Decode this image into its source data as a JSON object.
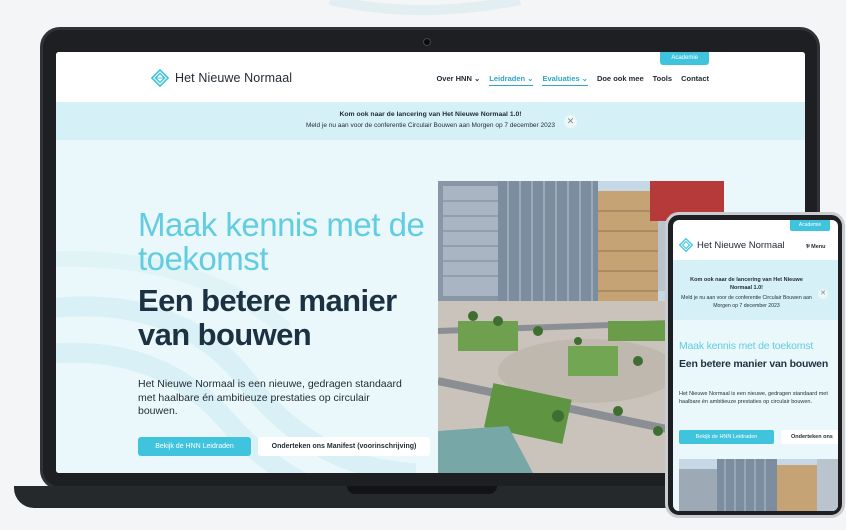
{
  "site": {
    "logo_text": "Het Nieuwe Normaal",
    "academy_tab": "Academie"
  },
  "nav": {
    "items": [
      {
        "label": "Over HNN ⌄"
      },
      {
        "label": "Leidraden ⌄"
      },
      {
        "label": "Evaluaties ⌄"
      },
      {
        "label": "Doe ook mee"
      },
      {
        "label": "Tools"
      },
      {
        "label": "Contact"
      }
    ]
  },
  "banner": {
    "title": "Kom ook naar de lancering van Het Nieuwe Normaal 1.0!",
    "subtitle": "Meld je nu aan voor de conferentie Circulair Bouwen aan Morgen op 7 december 2023",
    "close": "✕"
  },
  "hero": {
    "heading_light": "Maak kennis met de toekomst",
    "heading_bold": "Een betere manier van bouwen",
    "body": "Het Nieuwe Normaal is een nieuwe, gedragen standaard met haalbare én ambitieuze prestaties op circulair bouwen.",
    "primary_button": "Bekijk de HNN Leidraden",
    "secondary_button": "Onderteken ons Manifest (voorinschrijving)"
  },
  "mobile": {
    "logo_text": "Het Nieuwe Normaal",
    "menu_label": "Menu",
    "academy_tab": "Academie",
    "banner_title": "Kom ook naar de lancering van Het Nieuwe Normaal 1.0!",
    "banner_subtitle": "Meld je nu aan voor de conferentie Circulair Bouwen aan Morgen op 7 december 2023",
    "heading_light": "Maak kennis met de toekomst",
    "heading_bold": "Een betere manier van bouwen",
    "body": "Het Nieuwe Normaal is een nieuwe, gedragen standaard met haalbare én ambitieuze prestaties op circulair bouwen.",
    "primary_button": "Bekijk de HNN Leidraden",
    "secondary_button": "Onderteken ons"
  },
  "colors": {
    "accent": "#40c4de",
    "heading_light": "#62cde0",
    "heading_dark": "#1c3242",
    "banner_bg": "#d5f1f7",
    "hero_bg": "#eaf8fb"
  }
}
